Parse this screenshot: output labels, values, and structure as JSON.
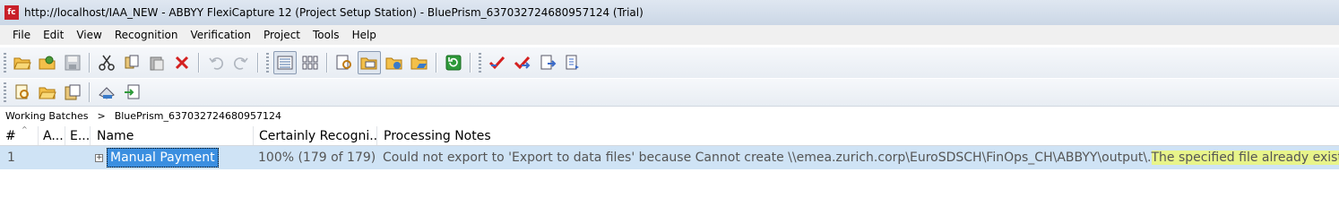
{
  "window": {
    "app_icon": "abbyy-fc-icon",
    "title": "http://localhost/IAA_NEW - ABBYY FlexiCapture 12 (Project Setup Station) - BluePrism_637032724680957124 (Trial)"
  },
  "menu": {
    "items": [
      "File",
      "Edit",
      "View",
      "Recognition",
      "Verification",
      "Project",
      "Tools",
      "Help"
    ]
  },
  "toolbar1": {
    "buttons": [
      {
        "icon": "open-folder-icon"
      },
      {
        "icon": "open-project-icon"
      },
      {
        "icon": "save-icon"
      },
      {
        "icon": "cut-icon"
      },
      {
        "icon": "copy-icon"
      },
      {
        "icon": "paste-icon"
      },
      {
        "icon": "delete-icon"
      },
      {
        "icon": "undo-icon"
      },
      {
        "icon": "redo-icon"
      },
      {
        "icon": "details-view-icon"
      },
      {
        "icon": "thumbnails-view-icon"
      },
      {
        "icon": "document-view-icon"
      },
      {
        "icon": "batch-folder-icon"
      },
      {
        "icon": "batch-types-icon"
      },
      {
        "icon": "batch-settings-icon"
      },
      {
        "icon": "refresh-icon"
      },
      {
        "icon": "verify-icon"
      },
      {
        "icon": "verify-next-icon"
      },
      {
        "icon": "export-icon"
      },
      {
        "icon": "export-next-icon"
      }
    ]
  },
  "toolbar2": {
    "buttons": [
      {
        "icon": "document-definition-icon"
      },
      {
        "icon": "open-batch-icon"
      },
      {
        "icon": "project-properties-icon"
      },
      {
        "icon": "scan-icon"
      },
      {
        "icon": "import-icon"
      }
    ]
  },
  "breadcrumb": {
    "root": "Working Batches",
    "separator": ">",
    "current": "BluePrism_637032724680957124"
  },
  "grid": {
    "columns": [
      "#",
      "A...",
      "E...",
      "Name",
      "Certainly Recogni...",
      "Processing Notes"
    ],
    "rows": [
      {
        "index": "1",
        "expander": "+",
        "name": "Manual Payment",
        "certainly_recognized": "100% (179 of 179)",
        "notes_main": "Could not export to 'Export to data files' because Cannot create \\\\emea.zurich.corp\\EuroSDSCH\\FinOps_CH\\ABBYY\\output\\.",
        "notes_highlighted": " The specified file already exists."
      }
    ],
    "highlight_color": "#e8f48a",
    "selection_color": "#3b8fe0"
  }
}
